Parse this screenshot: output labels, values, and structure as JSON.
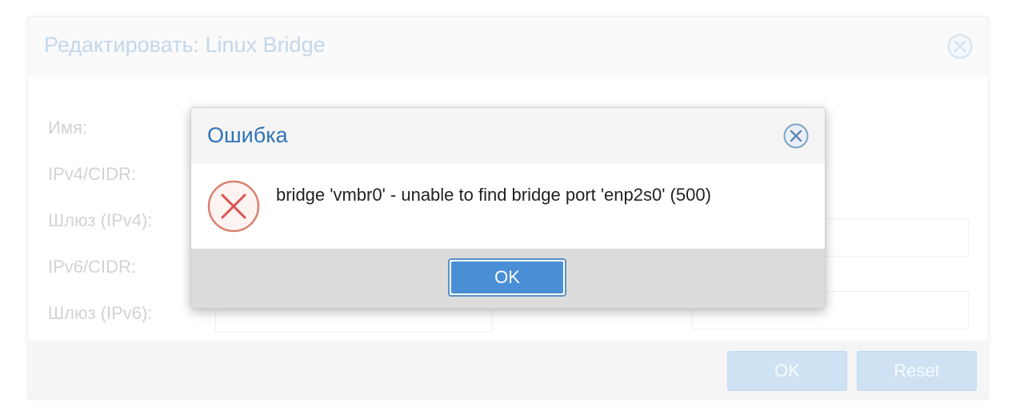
{
  "background_dialog": {
    "title": "Редактировать: Linux Bridge",
    "fields": {
      "name_label": "Имя:",
      "ipv4_cidr_label": "IPv4/CIDR:",
      "gateway_ipv4_label": "Шлюз (IPv4):",
      "ipv6_cidr_label": "IPv6/CIDR:",
      "gateway_ipv6_label": "Шлюз (IPv6):"
    },
    "buttons": {
      "ok_label": "OK",
      "reset_label": "Reset"
    }
  },
  "error_dialog": {
    "title": "Ошибка",
    "icon": "error-x-icon",
    "message": "bridge 'vmbr0' - unable to find bridge port 'enp2s0' (500)",
    "ok_label": "OK"
  },
  "colors": {
    "dialog_title": "#2f74b5",
    "ok_button": "#4a8fd6",
    "error_icon": "#d9534f"
  }
}
